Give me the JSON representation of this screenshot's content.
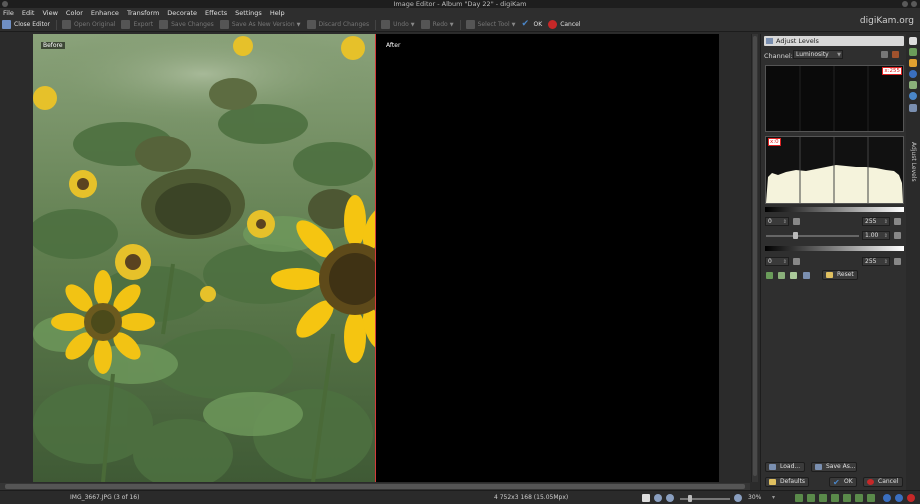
{
  "window": {
    "title": "Image Editor - Album \"Day 22\" - digiKam",
    "brand": "digiKam.org"
  },
  "menu": [
    "File",
    "Edit",
    "View",
    "Color",
    "Enhance",
    "Transform",
    "Decorate",
    "Effects",
    "Settings",
    "Help"
  ],
  "toolbar": {
    "close_editor": "Close Editor",
    "open_original": "Open Original",
    "export": "Export",
    "save_changes": "Save Changes",
    "save_as_new": "Save As New Version",
    "discard": "Discard Changes",
    "undo": "Undo",
    "redo": "Redo",
    "select_tool": "Select Tool",
    "ok": "OK",
    "cancel": "Cancel"
  },
  "preview": {
    "before_label": "Before",
    "after_label": "After"
  },
  "panel": {
    "title": "Adjust Levels",
    "channel_label": "Channel:",
    "channel_value": "Luminosity",
    "top_histogram_scale": "x:255",
    "bottom_histogram_scale": "x:0",
    "input_min": "0",
    "input_max": "255",
    "gamma": "1.00",
    "output_min": "0",
    "output_max": "255",
    "reset": "Reset",
    "load": "Load...",
    "save_as": "Save As...",
    "defaults": "Defaults",
    "ok": "OK",
    "cancel": "Cancel",
    "sidebar_tab": "Adjust Levels"
  },
  "status": {
    "filename": "IMG_3667.JPG (3 of 16)",
    "dimensions": "4 752x3 168 (15.05Mpx)",
    "zoom": "30%"
  },
  "colors": {
    "accent_red": "#d23b3b",
    "ok_blue": "#4a86c8",
    "cancel_red": "#c62828"
  }
}
